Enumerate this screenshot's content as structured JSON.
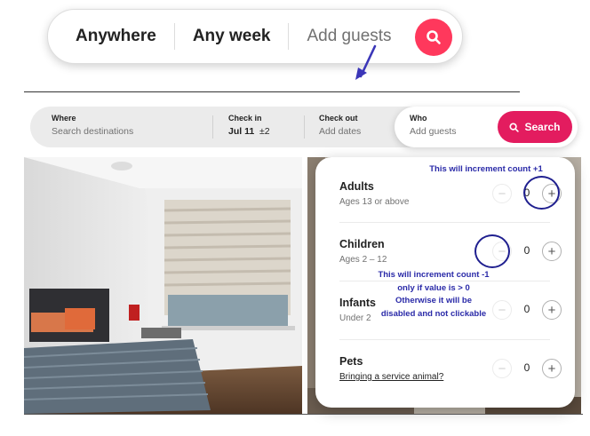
{
  "top_search": {
    "anywhere_label": "Anywhere",
    "any_week_label": "Any week",
    "add_guests_label": "Add guests"
  },
  "search_bar": {
    "where": {
      "label": "Where",
      "placeholder": "Search destinations"
    },
    "check_in": {
      "label": "Check in",
      "value": "Jul 11",
      "flex": "±2"
    },
    "check_out": {
      "label": "Check out",
      "placeholder": "Add dates"
    },
    "who": {
      "label": "Who",
      "placeholder": "Add guests"
    },
    "search_button": "Search"
  },
  "guests": [
    {
      "name": "Adults",
      "subtitle": "Ages 13 or above",
      "count": "0"
    },
    {
      "name": "Children",
      "subtitle": "Ages 2 – 12",
      "count": "0"
    },
    {
      "name": "Infants",
      "subtitle": "Under 2",
      "count": "0"
    },
    {
      "name": "Pets",
      "subtitle": "Bringing a service animal?",
      "count": "0"
    }
  ],
  "annotations": {
    "increment": "This will increment count +1",
    "decrement_line1": "This will increment count -1",
    "decrement_line2": "only if value is > 0",
    "decrement_line3": "Otherwise it will be",
    "decrement_line4": "disabled and not clickable"
  },
  "colors": {
    "brand": "#ff385c",
    "search_button": "#e31c5f",
    "annotation": "#2a2aa8"
  }
}
